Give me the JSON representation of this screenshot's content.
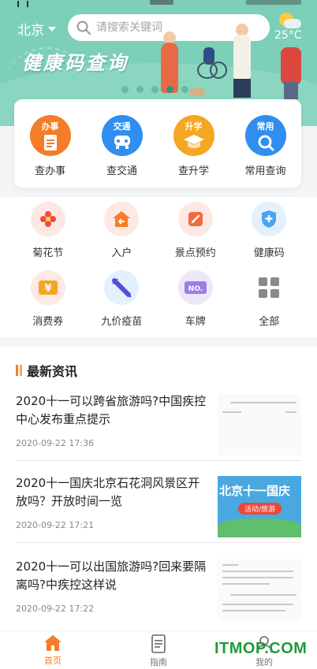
{
  "header": {
    "city": "北京",
    "search_placeholder": "请搜索关键词",
    "temperature": "25°C",
    "banner_title": "健康码查询",
    "carousel_total": 5,
    "carousel_active": 4
  },
  "primary_services": [
    {
      "tag": "办事",
      "label": "查办事",
      "color": "#f57c28",
      "icon": "document-icon"
    },
    {
      "tag": "交通",
      "label": "查交通",
      "color": "#2f8ef0",
      "icon": "car-icon"
    },
    {
      "tag": "升学",
      "label": "查升学",
      "color": "#f5a623",
      "icon": "graduation-cap-icon"
    },
    {
      "tag": "常用",
      "label": "常用查询",
      "color": "#2f8ef0",
      "icon": "search-icon"
    }
  ],
  "grid_items": [
    [
      {
        "label": "菊花节",
        "icon": "flower-icon",
        "bg": "#fde8e3"
      },
      {
        "label": "入户",
        "icon": "home-icon",
        "bg": "#fde8e3"
      },
      {
        "label": "景点预约",
        "icon": "edit-icon",
        "bg": "#fde8e3"
      },
      {
        "label": "健康码",
        "icon": "shield-plus-icon",
        "bg": "#e3f0fd"
      }
    ],
    [
      {
        "label": "消费券",
        "icon": "yen-coupon-icon",
        "bg": "#fde8e3"
      },
      {
        "label": "九价疫苗",
        "icon": "syringe-icon",
        "bg": "#e3f0fd"
      },
      {
        "label": "车牌",
        "icon": "license-plate-icon",
        "bg": "#ede8f9"
      },
      {
        "label": "全部",
        "icon": "grid-icon",
        "bg": "#ffffff"
      }
    ]
  ],
  "news": {
    "heading": "最新资讯",
    "items": [
      {
        "title": "2020十一可以跨省旅游吗?中国疾控中心发布重点提示",
        "date": "2020-09-22 17:36",
        "thumb": "doc"
      },
      {
        "title": "2020十一国庆北京石花洞风景区开放吗？开放时间一览",
        "date": "2020-09-22 17:21",
        "thumb": "blue",
        "thumb_text": "北京十一国庆",
        "thumb_pill": "活动/旅游"
      },
      {
        "title": "2020十一可以出国旅游吗?回来要隔离吗?中疾控这样说",
        "date": "2020-09-22 17:22",
        "thumb": "doc"
      }
    ]
  },
  "tabbar": [
    {
      "label": "首页",
      "icon": "home-tab-icon",
      "active": true
    },
    {
      "label": "指南",
      "icon": "guide-icon",
      "active": false
    },
    {
      "label": "我的",
      "icon": "user-icon",
      "active": false
    }
  ],
  "watermark": "ITMOP.COM",
  "colors": {
    "accent": "#f57c28",
    "banner": "#7ccfb8"
  }
}
